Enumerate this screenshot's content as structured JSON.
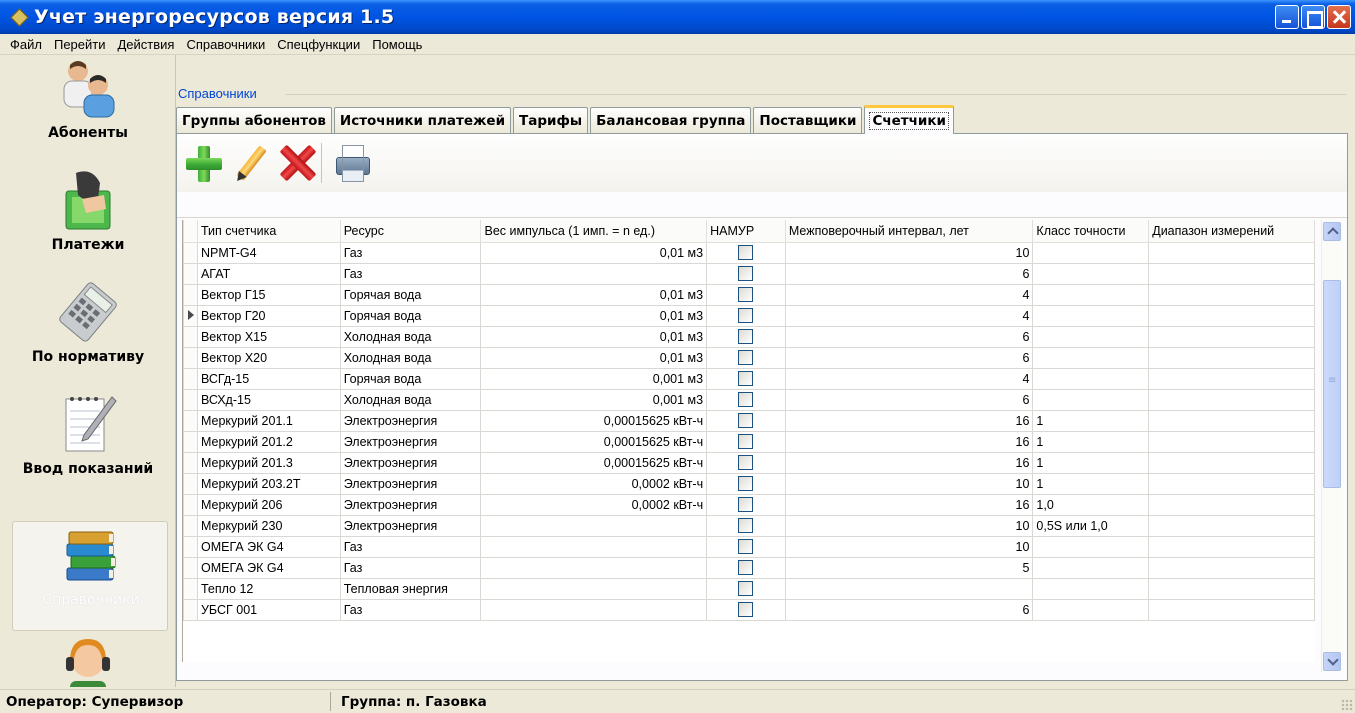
{
  "window": {
    "title": "Учет энергоресурсов версия 1.5"
  },
  "menu": [
    "Файл",
    "Перейти",
    "Действия",
    "Справочники",
    "Спецфункции",
    "Помощь"
  ],
  "nav": [
    {
      "label": "Абоненты",
      "icon": "users-icon"
    },
    {
      "label": "Платежи",
      "icon": "payment-hand-icon"
    },
    {
      "label": "По нормативу",
      "icon": "calculator-icon"
    },
    {
      "label": "Ввод показаний",
      "icon": "notepad-pencil-icon"
    },
    {
      "label": "Справочники",
      "icon": "books-icon",
      "active": true
    },
    {
      "label": "",
      "icon": "operator-headset-icon"
    }
  ],
  "section": {
    "caption": "Справочники"
  },
  "tabs": [
    "Группы абонентов",
    "Источники платежей",
    "Тарифы",
    "Балансовая группа",
    "Поставщики",
    "Счетчики"
  ],
  "active_tab": "Счетчики",
  "toolbar": {
    "add": "add-icon",
    "edit": "edit-pencil-icon",
    "delete": "delete-icon",
    "print": "printer-icon"
  },
  "grid": {
    "columns": [
      "Тип счетчика",
      "Ресурс",
      "Вес импульса (1 имп. = n ед.)",
      "НАМУР",
      "Межповерочный интервал, лет",
      "Класс точности",
      "Диапазон измерений"
    ],
    "rows": [
      [
        "NPMT-G4",
        "Газ",
        "0,01 м3",
        "",
        "10",
        "",
        ""
      ],
      [
        "АГАТ",
        "Газ",
        "",
        "",
        "6",
        "",
        ""
      ],
      [
        "Вектор Г15",
        "Горячая вода",
        "0,01 м3",
        "",
        "4",
        "",
        ""
      ],
      [
        "Вектор Г20",
        "Горячая вода",
        "0,01 м3",
        "",
        "4",
        "",
        ""
      ],
      [
        "Вектор Х15",
        "Холодная вода",
        "0,01 м3",
        "",
        "6",
        "",
        ""
      ],
      [
        "Вектор Х20",
        "Холодная вода",
        "0,01 м3",
        "",
        "6",
        "",
        ""
      ],
      [
        "ВСГд-15",
        "Горячая вода",
        "0,001 м3",
        "",
        "4",
        "",
        ""
      ],
      [
        "ВСХд-15",
        "Холодная вода",
        "0,001 м3",
        "",
        "6",
        "",
        ""
      ],
      [
        "Меркурий 201.1",
        "Электроэнергия",
        "0,00015625 кВт-ч",
        "",
        "16",
        "1",
        ""
      ],
      [
        "Меркурий 201.2",
        "Электроэнергия",
        "0,00015625 кВт-ч",
        "",
        "16",
        "1",
        ""
      ],
      [
        "Меркурий 201.3",
        "Электроэнергия",
        "0,00015625 кВт-ч",
        "",
        "16",
        "1",
        ""
      ],
      [
        "Меркурий 203.2Т",
        "Электроэнергия",
        "0,0002 кВт-ч",
        "",
        "10",
        "1",
        ""
      ],
      [
        "Меркурий 206",
        "Электроэнергия",
        "0,0002 кВт-ч",
        "",
        "16",
        "1,0",
        ""
      ],
      [
        "Меркурий 230",
        "Электроэнергия",
        "",
        "",
        "10",
        "0,5S или 1,0",
        ""
      ],
      [
        "ОМЕГА ЭК G4",
        "Газ",
        "",
        "",
        "10",
        "",
        ""
      ],
      [
        "ОМЕГА ЭК G4",
        "Газ",
        "",
        "",
        "5",
        "",
        ""
      ],
      [
        "Тепло 12",
        "Тепловая энергия",
        "",
        "",
        "",
        "",
        ""
      ],
      [
        "УБСГ 001",
        "Газ",
        "",
        "",
        "6",
        "",
        ""
      ]
    ],
    "current_row": 3
  },
  "status": {
    "operator": "Оператор: Супервизор",
    "group": "Группа: п. Газовка"
  }
}
